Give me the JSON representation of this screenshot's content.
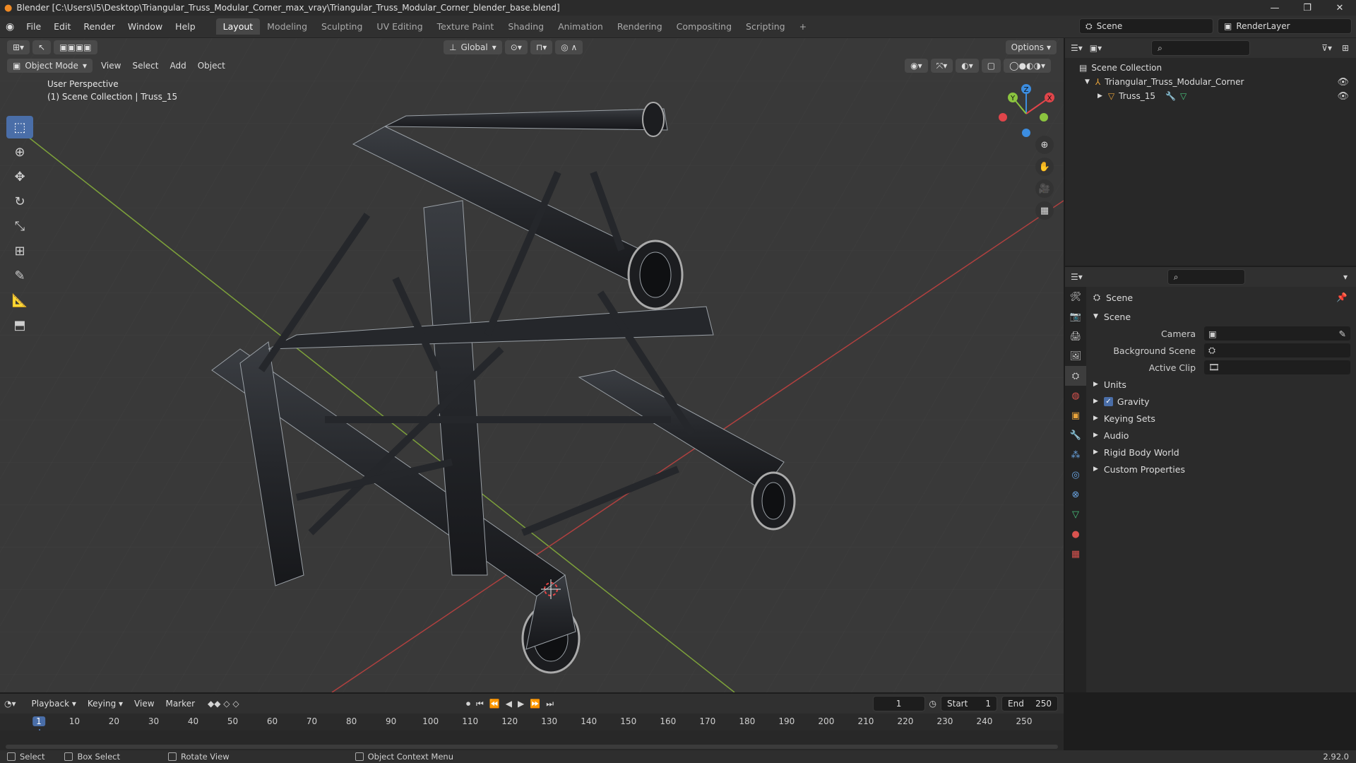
{
  "window": {
    "title": "Blender [C:\\Users\\I5\\Desktop\\Triangular_Truss_Modular_Corner_max_vray\\Triangular_Truss_Modular_Corner_blender_base.blend]",
    "minimize": "—",
    "maximize": "❐",
    "close": "✕"
  },
  "menu": [
    "File",
    "Edit",
    "Render",
    "Window",
    "Help"
  ],
  "workspaces": [
    "Layout",
    "Modeling",
    "Sculpting",
    "UV Editing",
    "Texture Paint",
    "Shading",
    "Animation",
    "Rendering",
    "Compositing",
    "Scripting"
  ],
  "workspace_add": "+",
  "top_right": {
    "scene": "Scene",
    "render_layer": "RenderLayer"
  },
  "viewport": {
    "mode": "Object Mode",
    "menus": [
      "View",
      "Select",
      "Add",
      "Object"
    ],
    "transform_orientation": "Global",
    "options": "Options",
    "info_line1": "User Perspective",
    "info_line2": "(1) Scene Collection | Truss_15",
    "gizmo": {
      "x": "X",
      "y": "Y",
      "z": "Z"
    }
  },
  "outliner": {
    "root": "Scene Collection",
    "items": [
      {
        "label": "Triangular_Truss_Modular_Corner"
      },
      {
        "label": "Truss_15"
      }
    ]
  },
  "properties": {
    "header": "Scene",
    "panel_title": "Scene",
    "fields": [
      {
        "label": "Camera",
        "value": ""
      },
      {
        "label": "Background Scene",
        "value": ""
      },
      {
        "label": "Active Clip",
        "value": ""
      }
    ],
    "sections": [
      "Units",
      "Gravity",
      "Keying Sets",
      "Audio",
      "Rigid Body World",
      "Custom Properties"
    ],
    "gravity_checked": true
  },
  "timeline": {
    "menus": [
      "Playback",
      "Keying",
      "View",
      "Marker"
    ],
    "current_frame": "1",
    "start_label": "Start",
    "start": "1",
    "end_label": "End",
    "end": "250",
    "ruler": [
      "1",
      "10",
      "20",
      "30",
      "40",
      "50",
      "60",
      "70",
      "80",
      "90",
      "100",
      "110",
      "120",
      "130",
      "140",
      "150",
      "160",
      "170",
      "180",
      "190",
      "200",
      "210",
      "220",
      "230",
      "240",
      "250"
    ]
  },
  "status": {
    "select": "Select",
    "box_select": "Box Select",
    "rotate_view": "Rotate View",
    "context_menu": "Object Context Menu",
    "version": "2.92.0"
  },
  "colors": {
    "accent": "#4a6ea8",
    "x_axis": "#e0454a",
    "y_axis": "#8bc43f",
    "z_axis": "#3c8de0"
  }
}
